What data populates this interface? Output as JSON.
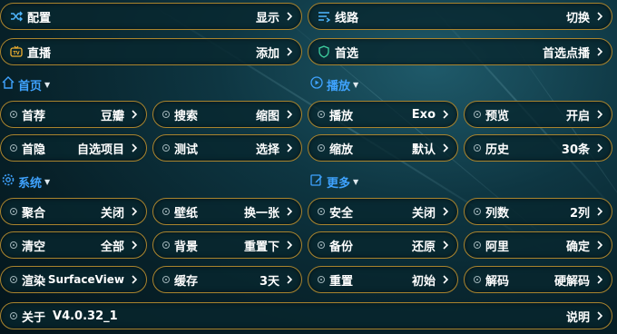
{
  "top": {
    "config": {
      "label": "配置",
      "value": "显示"
    },
    "route": {
      "label": "线路",
      "value": "切换"
    },
    "live": {
      "label": "直播",
      "value": "添加"
    },
    "preferred": {
      "label": "首选",
      "value": "首选点播"
    }
  },
  "sections": {
    "home": {
      "title": "首页"
    },
    "play": {
      "title": "播放"
    },
    "system": {
      "title": "系统"
    },
    "more": {
      "title": "更多"
    }
  },
  "home_items": [
    {
      "label": "首荐",
      "value": "豆瓣"
    },
    {
      "label": "搜索",
      "value": "缩图"
    },
    {
      "label": "首隐",
      "value": "自选项目"
    },
    {
      "label": "测试",
      "value": "选择"
    }
  ],
  "play_items": [
    {
      "label": "播放",
      "value": "Exo"
    },
    {
      "label": "预览",
      "value": "开启"
    },
    {
      "label": "缩放",
      "value": "默认"
    },
    {
      "label": "历史",
      "value": "30条"
    }
  ],
  "system_items": [
    {
      "label": "聚合",
      "value": "关闭"
    },
    {
      "label": "壁纸",
      "value": "换一张"
    },
    {
      "label": "清空",
      "value": "全部"
    },
    {
      "label": "背景",
      "value": "重置下"
    },
    {
      "label": "渲染",
      "value": "SurfaceView"
    },
    {
      "label": "缓存",
      "value": "3天"
    }
  ],
  "more_items": [
    {
      "label": "安全",
      "value": "关闭"
    },
    {
      "label": "列数",
      "value": "2列"
    },
    {
      "label": "备份",
      "value": "还原"
    },
    {
      "label": "阿里",
      "value": "确定"
    },
    {
      "label": "重置",
      "value": "初始"
    },
    {
      "label": "解码",
      "value": "硬解码"
    }
  ],
  "about": {
    "label": "关于",
    "version": "V4.0.32_1",
    "value": "说明"
  },
  "colors": {
    "accent": "#3fa3ff",
    "border": "#a9842e",
    "background": "#0e3642"
  }
}
